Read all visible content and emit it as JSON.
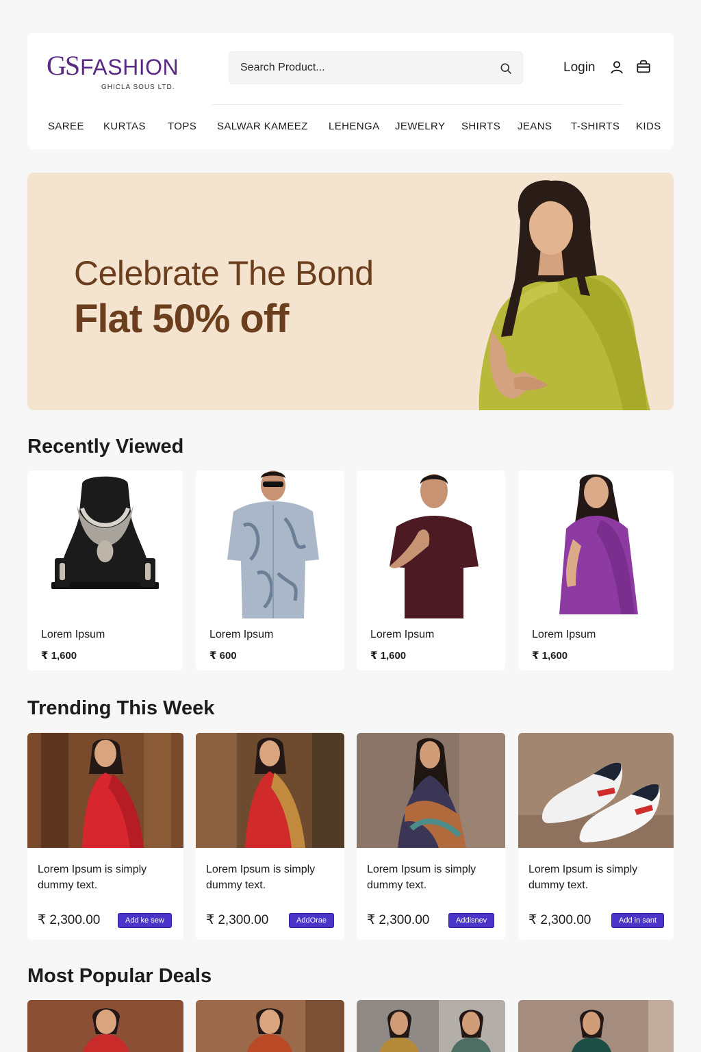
{
  "brand": {
    "logo_gs": "GS",
    "logo_fashion": "FASHION",
    "tagline": "GHICLA SOUS LTD."
  },
  "search": {
    "placeholder": "Search Product..."
  },
  "account": {
    "login_label": "Login"
  },
  "nav": [
    "SAREE",
    "KURTAS",
    "TOPS",
    "SALWAR KAMEEZ",
    "LEHENGA",
    "JEWELRY",
    "SHIRTS",
    "JEANS",
    "T-SHIRTS",
    "KIDS"
  ],
  "hero": {
    "title": "Celebrate The Bond",
    "offer": "Flat 50% off"
  },
  "recently_viewed": {
    "title": "Recently Viewed",
    "items": [
      {
        "name": "Lorem Ipsum",
        "price": "₹ 1,600"
      },
      {
        "name": "Lorem Ipsum",
        "price": "₹ 600"
      },
      {
        "name": "Lorem Ipsum",
        "price": "₹ 1,600"
      },
      {
        "name": "Lorem Ipsum",
        "price": "₹ 1,600"
      }
    ]
  },
  "trending": {
    "title": "Trending This Week",
    "items": [
      {
        "desc": "Lorem Ipsum is simply dummy text.",
        "price": "₹ 2,300.00",
        "button": "Add ke sew"
      },
      {
        "desc": "Lorem Ipsum is simply dummy text.",
        "price": "₹ 2,300.00",
        "button": "AddOrae"
      },
      {
        "desc": "Lorem Ipsum is simply dummy text.",
        "price": "₹ 2,300.00",
        "button": "Addisnev"
      },
      {
        "desc": "Lorem Ipsum is simply dummy text.",
        "price": "₹ 2,300.00",
        "button": "Add in sant"
      }
    ]
  },
  "popular": {
    "title": "Most Popular Deals"
  },
  "colors": {
    "brand": "#5a2a82",
    "hero_bg": "#f3e3cf",
    "hero_text": "#6b3f1d",
    "button": "#4b35c9"
  }
}
